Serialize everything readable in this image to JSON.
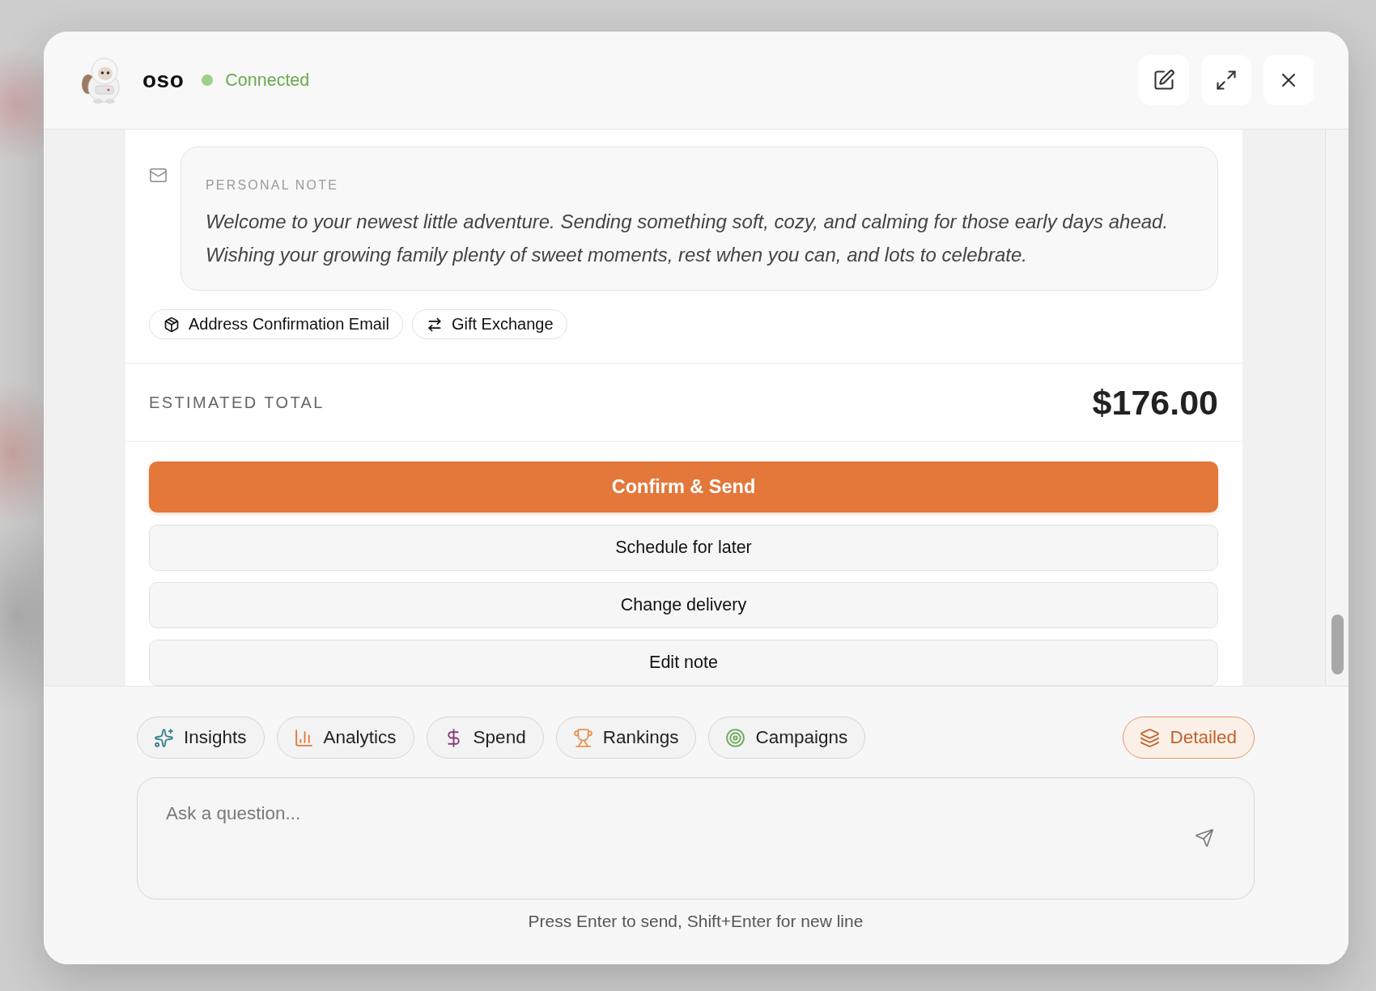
{
  "header": {
    "title": "oso",
    "status": {
      "label": "Connected",
      "connected": true
    }
  },
  "note": {
    "label": "PERSONAL NOTE",
    "text": "Welcome to your newest little adventure. Sending something soft, cozy, and calming for those early days ahead. Wishing your growing family plenty of sweet moments, rest when you can, and lots to celebrate."
  },
  "tags": [
    {
      "kind": "package",
      "label": "Address Confirmation Email"
    },
    {
      "kind": "exchange",
      "label": "Gift Exchange"
    }
  ],
  "total": {
    "label": "ESTIMATED TOTAL",
    "amount": "$176.00"
  },
  "actions": [
    {
      "kind": "primary",
      "label": "Confirm & Send"
    },
    {
      "kind": "secondary",
      "label": "Schedule for later"
    },
    {
      "kind": "secondary",
      "label": "Change delivery"
    },
    {
      "kind": "secondary",
      "label": "Edit note"
    }
  ],
  "toolbar": {
    "chips": [
      {
        "kind": "sparkle",
        "label": "Insights",
        "color": "#3b7f8e"
      },
      {
        "kind": "bars",
        "label": "Analytics",
        "color": "#e3783a"
      },
      {
        "kind": "dollar",
        "label": "Spend",
        "color": "#8b3a7b"
      },
      {
        "kind": "trophy",
        "label": "Rankings",
        "color": "#e8914f"
      },
      {
        "kind": "target",
        "label": "Campaigns",
        "color": "#6aaa58"
      }
    ],
    "detailed": {
      "label": "Detailed",
      "on": true
    }
  },
  "composer": {
    "placeholder": "Ask a question...",
    "hint": "Press Enter to send, Shift+Enter for new line"
  }
}
